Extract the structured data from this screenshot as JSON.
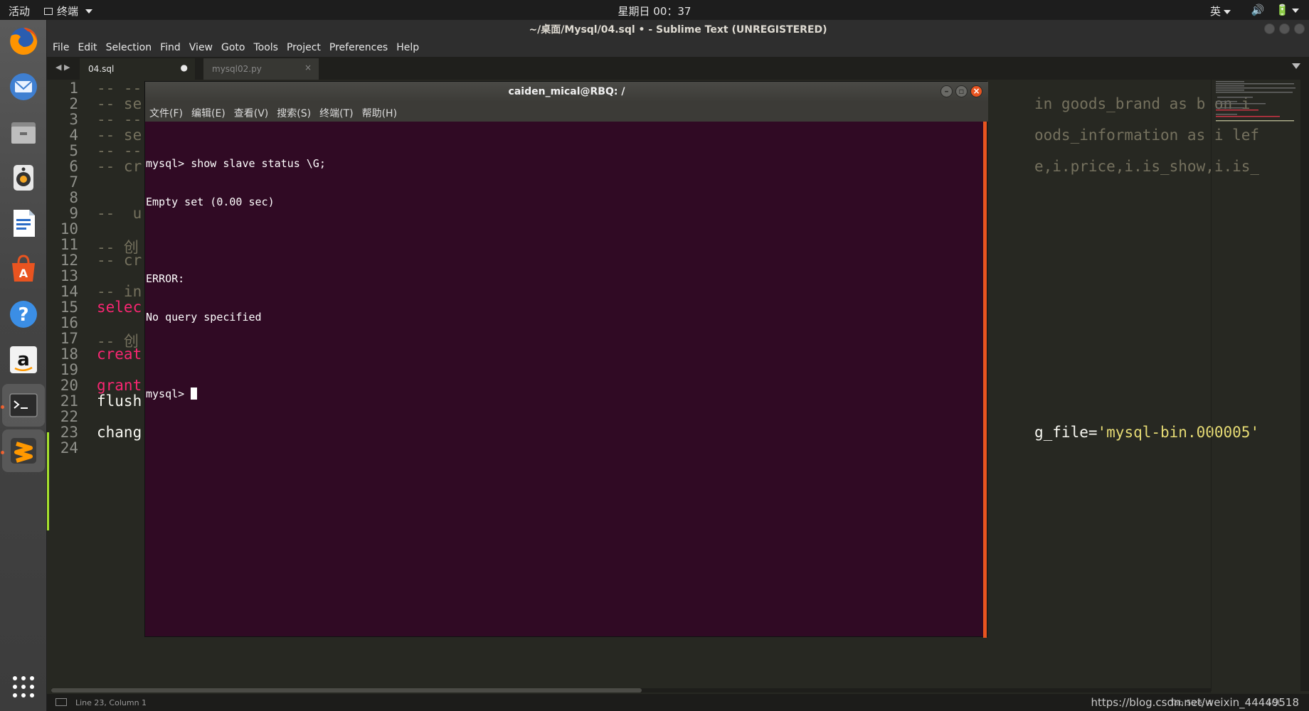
{
  "topbar": {
    "activities": "活动",
    "app_menu": "终端",
    "clock": "星期日 00：37",
    "input_lang": "英"
  },
  "sublime": {
    "window_title": "~/桌面/Mysql/04.sql • - Sublime Text (UNREGISTERED)",
    "menu": [
      "File",
      "Edit",
      "Selection",
      "Find",
      "View",
      "Goto",
      "Tools",
      "Project",
      "Preferences",
      "Help"
    ],
    "tabs": [
      {
        "label": "04.sql",
        "mark": "●",
        "active": true
      },
      {
        "label": "mysql02.py",
        "mark": "×",
        "active": false
      }
    ],
    "line_numbers": [
      "1",
      "2",
      "3",
      "4",
      "5",
      "6",
      "7",
      "8",
      "9",
      "10",
      "11",
      "12",
      "13",
      "14",
      "15",
      "16",
      "17",
      "18",
      "19",
      "20",
      "21",
      "22",
      "23",
      "24"
    ],
    "code_left": {
      "l1": "-- --",
      "l2": "-- se",
      "l3": "-- --",
      "l4": "-- se",
      "l5": "-- --",
      "l6": "-- cr",
      "l9": "--  u",
      "l11": "-- 创",
      "l12": "-- cr",
      "l14": "-- in",
      "l15": "selec",
      "l17": "-- 创",
      "l18": "creat",
      "l20": "grant",
      "l21": "flush",
      "l23": "chang"
    },
    "code_right": {
      "l2": "in goods_brand as b on i",
      "l4": "oods_information as i lef",
      "l6": "e,i.price,i.is_show,i.is_",
      "l23_pre": "g_file=",
      "l23_str": "'mysql-bin.000005'"
    },
    "status": {
      "position": "Line 23, Column 1",
      "tab_size": "Tab Size: 4",
      "syntax": "SQL"
    },
    "watermark": "https://blog.csdn.net/weixin_44449518"
  },
  "terminal": {
    "title": "caiden_mical@RBQ: /",
    "menu": [
      "文件(F)",
      "编辑(E)",
      "查看(V)",
      "搜索(S)",
      "终端(T)",
      "帮助(H)"
    ],
    "lines": [
      "mysql> show slave status \\G;",
      "Empty set (0.00 sec)",
      "",
      "ERROR:",
      "No query specified",
      ""
    ],
    "prompt": "mysql> "
  },
  "dock": {
    "apps": [
      "firefox-icon",
      "thunderbird-icon",
      "files-icon",
      "rhythmbox-icon",
      "libreoffice-writer-icon",
      "software-center-icon",
      "help-icon",
      "amazon-icon",
      "terminal-icon",
      "sublime-text-icon",
      "show-apps-icon"
    ]
  },
  "colors": {
    "terminal_bg": "#300a24",
    "ubuntu_orange": "#e95420",
    "monokai_bg": "#272822",
    "monokai_comment": "#75715e",
    "monokai_keyword": "#f92672",
    "monokai_string": "#e6db74"
  }
}
